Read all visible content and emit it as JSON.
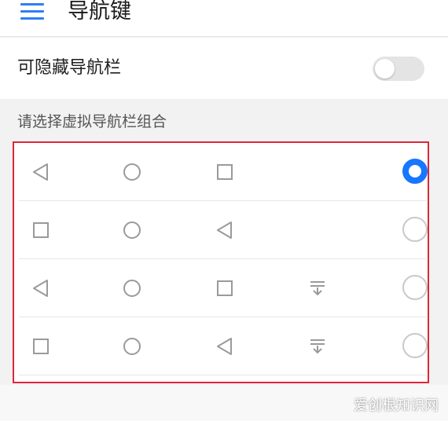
{
  "header": {
    "title": "导航键",
    "menu_icon": "menu-icon"
  },
  "hide_navbar": {
    "label": "可隐藏导航栏",
    "enabled": false
  },
  "combo_section": {
    "title": "请选择虚拟导航栏组合",
    "options": [
      {
        "icons": [
          "back-triangle",
          "home-circle",
          "recents-square"
        ],
        "selected": true
      },
      {
        "icons": [
          "recents-square",
          "home-circle",
          "back-triangle"
        ],
        "selected": false
      },
      {
        "icons": [
          "back-triangle",
          "home-circle",
          "recents-square",
          "notification-pulldown"
        ],
        "selected": false
      },
      {
        "icons": [
          "recents-square",
          "home-circle",
          "back-triangle",
          "notification-pulldown"
        ],
        "selected": false
      }
    ]
  },
  "accent_color": "#1677ff",
  "highlight_border_color": "#e0253b",
  "watermark": "爱创根知识网"
}
